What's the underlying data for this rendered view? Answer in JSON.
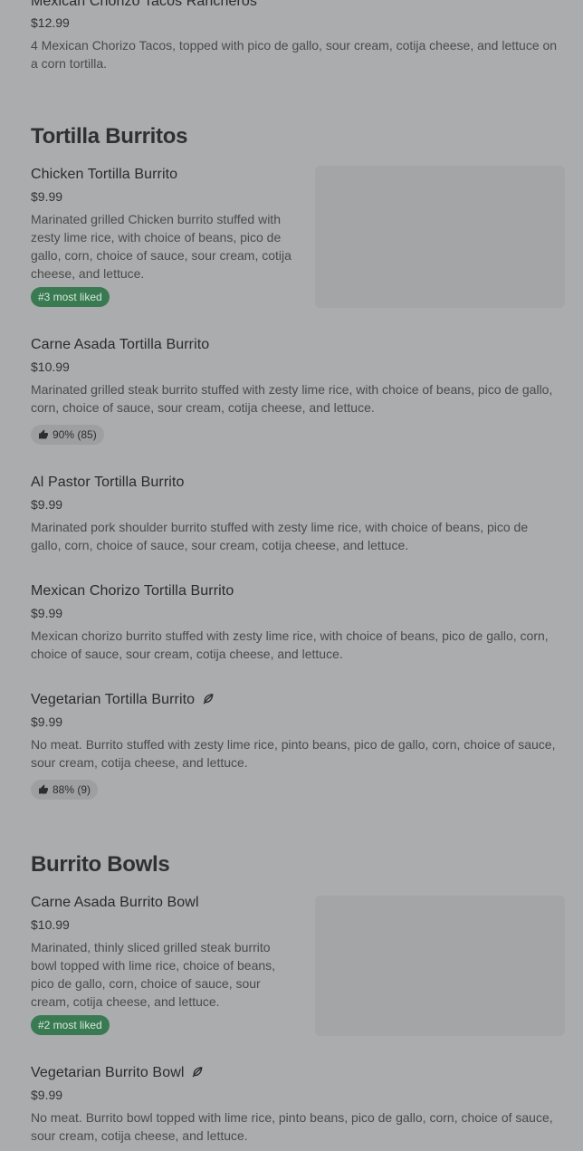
{
  "top_item": {
    "name": "Mexican Chorizo Tacos Rancheros",
    "price": "$12.99",
    "desc": "4 Mexican Chorizo Tacos, topped with pico de gallo, sour cream, cotija cheese, and lettuce on a corn tortilla."
  },
  "tortilla": {
    "title": "Tortilla Burritos",
    "items": [
      {
        "name": "Chicken Tortilla Burrito",
        "price": "$9.99",
        "desc": "Marinated grilled Chicken burrito stuffed with zesty lime rice, with choice of beans, pico de gallo, corn, choice of sauce, sour cream, cotija cheese, and lettuce.",
        "badge": "#3 most liked"
      },
      {
        "name": "Carne Asada Tortilla Burrito",
        "price": "$10.99",
        "desc": "Marinated grilled steak burrito stuffed with zesty lime rice, with choice of beans, pico de gallo, corn, choice of sauce, sour cream, cotija cheese, and lettuce.",
        "rating": "90% (85)"
      },
      {
        "name": "Al Pastor Tortilla Burrito",
        "price": "$9.99",
        "desc": "Marinated pork shoulder burrito stuffed with zesty lime rice, with choice of beans, pico de gallo, corn, choice of sauce, sour cream, cotija cheese, and lettuce."
      },
      {
        "name": "Mexican Chorizo Tortilla Burrito",
        "price": "$9.99",
        "desc": "Mexican chorizo burrito stuffed with zesty lime rice, with choice of beans, pico de gallo, corn, choice of sauce, sour cream, cotija cheese, and lettuce."
      },
      {
        "name": "Vegetarian Tortilla Burrito",
        "price": "$9.99",
        "desc": "No meat. Burrito stuffed with zesty lime rice, pinto beans, pico de gallo, corn, choice of sauce, sour cream, cotija cheese, and lettuce.",
        "rating": "88% (9)"
      }
    ]
  },
  "bowls": {
    "title": "Burrito Bowls",
    "items": [
      {
        "name": "Carne Asada Burrito Bowl",
        "price": "$10.99",
        "desc": "Marinated, thinly sliced grilled steak burrito bowl topped with lime rice, choice of beans, pico de gallo, corn, choice of sauce, sour cream, cotija cheese, and lettuce.",
        "badge": "#2 most liked"
      },
      {
        "name": "Vegetarian Burrito Bowl",
        "price": "$9.99",
        "desc": "No meat. Burrito bowl topped with lime rice, pinto beans, pico de gallo, corn, choice of sauce, sour cream, cotija cheese, and lettuce."
      }
    ]
  },
  "icons": {
    "thumbs_up": "thumbs-up-icon",
    "vegetarian": "leaf-icon"
  },
  "colors": {
    "overlay_bg": "#aaacad",
    "badge_green": "#3a7a52",
    "badge_gray": "#9d9fa0"
  }
}
